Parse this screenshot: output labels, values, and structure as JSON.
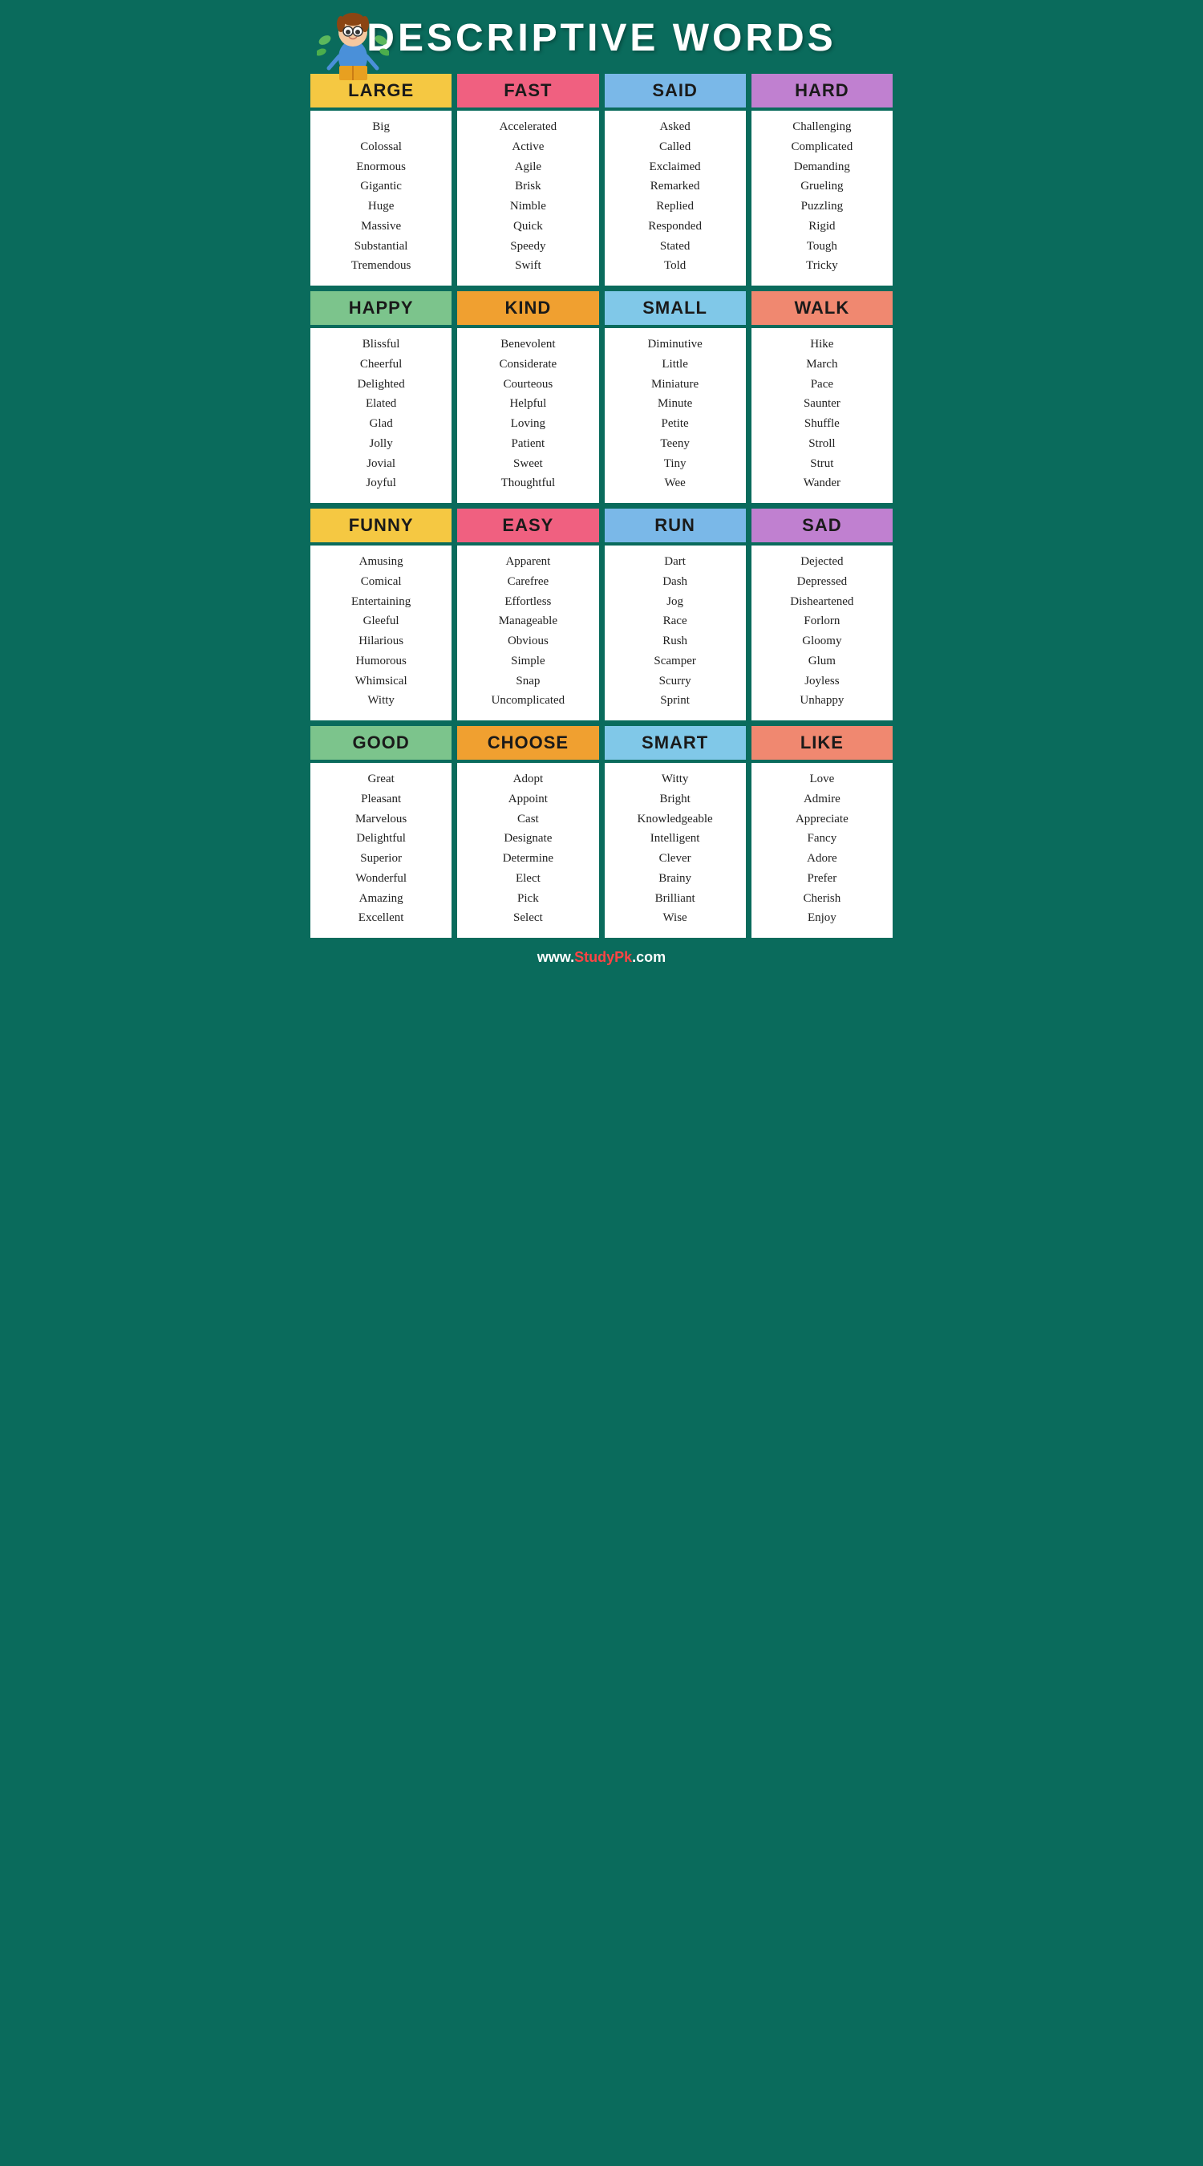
{
  "title": "DESCRIPTIVE WORDS",
  "footer": {
    "prefix": "www.",
    "site": "StudyPk",
    "suffix": ".com"
  },
  "sections": [
    {
      "header": "LARGE",
      "headerColor": "yellow",
      "words": [
        "Big",
        "Colossal",
        "Enormous",
        "Gigantic",
        "Huge",
        "Massive",
        "Substantial",
        "Tremendous"
      ]
    },
    {
      "header": "FAST",
      "headerColor": "pink",
      "words": [
        "Accelerated",
        "Active",
        "Agile",
        "Brisk",
        "Nimble",
        "Quick",
        "Speedy",
        "Swift"
      ]
    },
    {
      "header": "SAID",
      "headerColor": "blue",
      "words": [
        "Asked",
        "Called",
        "Exclaimed",
        "Remarked",
        "Replied",
        "Responded",
        "Stated",
        "Told"
      ]
    },
    {
      "header": "HARD",
      "headerColor": "purple",
      "words": [
        "Challenging",
        "Complicated",
        "Demanding",
        "Grueling",
        "Puzzling",
        "Rigid",
        "Tough",
        "Tricky"
      ]
    },
    {
      "header": "HAPPY",
      "headerColor": "green",
      "words": [
        "Blissful",
        "Cheerful",
        "Delighted",
        "Elated",
        "Glad",
        "Jolly",
        "Jovial",
        "Joyful"
      ]
    },
    {
      "header": "KIND",
      "headerColor": "orange",
      "words": [
        "Benevolent",
        "Considerate",
        "Courteous",
        "Helpful",
        "Loving",
        "Patient",
        "Sweet",
        "Thoughtful"
      ]
    },
    {
      "header": "SMALL",
      "headerColor": "lightblue",
      "words": [
        "Diminutive",
        "Little",
        "Miniature",
        "Minute",
        "Petite",
        "Teeny",
        "Tiny",
        "Wee"
      ]
    },
    {
      "header": "WALK",
      "headerColor": "salmon",
      "words": [
        "Hike",
        "March",
        "Pace",
        "Saunter",
        "Shuffle",
        "Stroll",
        "Strut",
        "Wander"
      ]
    },
    {
      "header": "FUNNY",
      "headerColor": "yellow",
      "words": [
        "Amusing",
        "Comical",
        "Entertaining",
        "Gleeful",
        "Hilarious",
        "Humorous",
        "Whimsical",
        "Witty"
      ]
    },
    {
      "header": "EASY",
      "headerColor": "pink",
      "words": [
        "Apparent",
        "Carefree",
        "Effortless",
        "Manageable",
        "Obvious",
        "Simple",
        "Snap",
        "Uncomplicated"
      ]
    },
    {
      "header": "RUN",
      "headerColor": "blue",
      "words": [
        "Dart",
        "Dash",
        "Jog",
        "Race",
        "Rush",
        "Scamper",
        "Scurry",
        "Sprint"
      ]
    },
    {
      "header": "SAD",
      "headerColor": "purple",
      "words": [
        "Dejected",
        "Depressed",
        "Disheartened",
        "Forlorn",
        "Gloomy",
        "Glum",
        "Joyless",
        "Unhappy"
      ]
    },
    {
      "header": "GOOD",
      "headerColor": "green",
      "words": [
        "Great",
        "Pleasant",
        "Marvelous",
        "Delightful",
        "Superior",
        "Wonderful",
        "Amazing",
        "Excellent"
      ]
    },
    {
      "header": "CHOOSE",
      "headerColor": "orange",
      "words": [
        "Adopt",
        "Appoint",
        "Cast",
        "Designate",
        "Determine",
        "Elect",
        "Pick",
        "Select"
      ]
    },
    {
      "header": "SMART",
      "headerColor": "lightblue",
      "words": [
        "Witty",
        "Bright",
        "Knowledgeable",
        "Intelligent",
        "Clever",
        "Brainy",
        "Brilliant",
        "Wise"
      ]
    },
    {
      "header": "LIKE",
      "headerColor": "salmon",
      "words": [
        "Love",
        "Admire",
        "Appreciate",
        "Fancy",
        "Adore",
        "Prefer",
        "Cherish",
        "Enjoy"
      ]
    }
  ]
}
